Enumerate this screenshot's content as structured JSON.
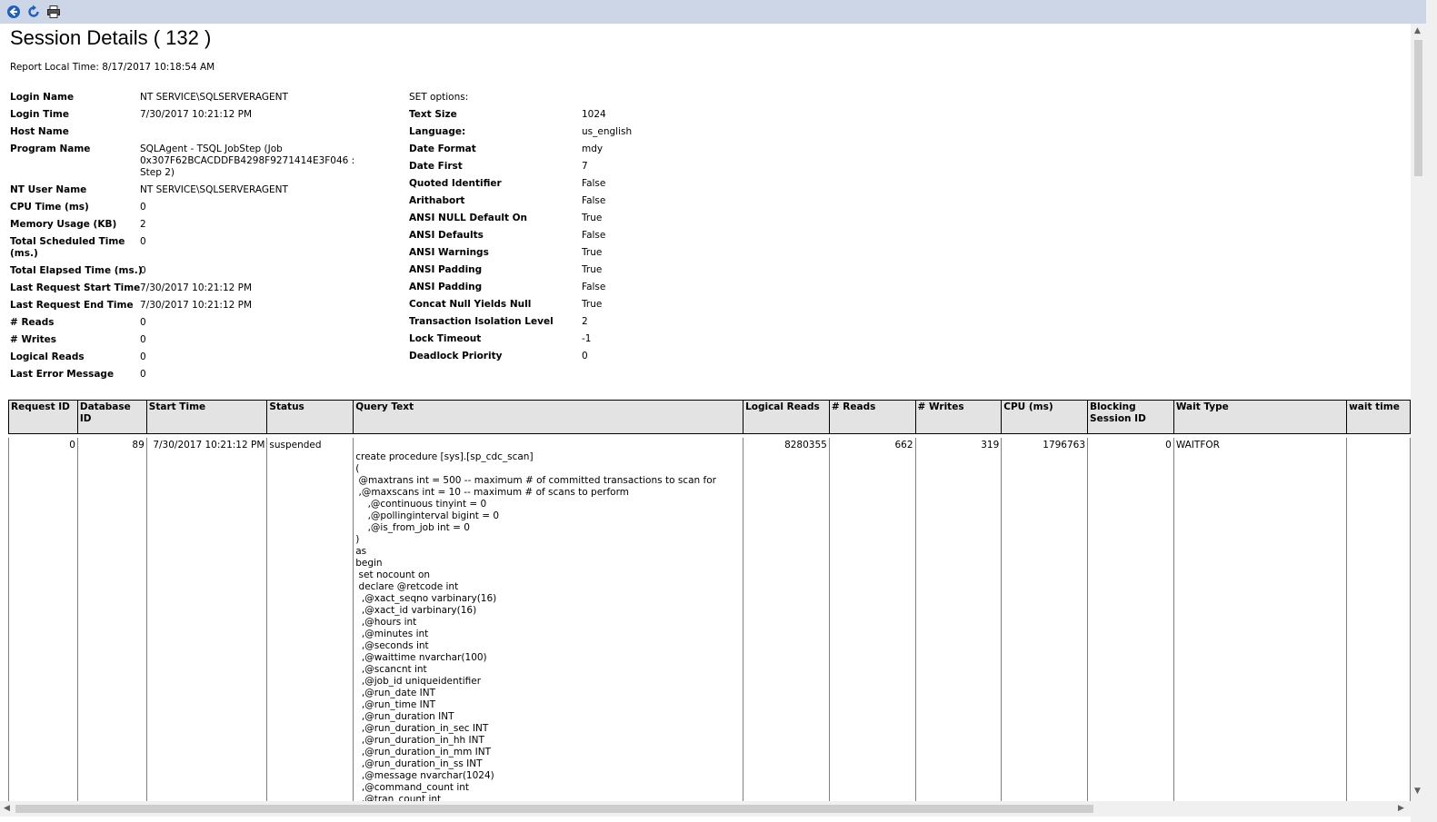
{
  "toolbar": {
    "buttons": [
      "back-icon",
      "refresh-icon",
      "print-icon"
    ]
  },
  "title": "Session Details ( 132 )",
  "report_time": "Report Local Time: 8/17/2017 10:18:54 AM",
  "session": [
    {
      "label": "Login Name",
      "value": "NT SERVICE\\SQLSERVERAGENT"
    },
    {
      "label": "Login Time",
      "value": "7/30/2017 10:21:12 PM"
    },
    {
      "label": "Host Name",
      "value": ""
    },
    {
      "label": "Program Name",
      "value": "SQLAgent - TSQL JobStep (Job"
    },
    {
      "label": "NT User Name",
      "value": "NT SERVICE\\SQLSERVERAGENT"
    },
    {
      "label": "CPU Time (ms)",
      "value": "0"
    },
    {
      "label": "Memory Usage (KB)",
      "value": "2"
    },
    {
      "label": "Total Scheduled Time",
      "value": "0"
    },
    {
      "label": "Total Elapsed Time (ms.)",
      "value": "0"
    },
    {
      "label": "Last Request Start Time",
      "value": "7/30/2017 10:21:12 PM"
    },
    {
      "label": "Last Request End Time",
      "value": "7/30/2017 10:21:12 PM"
    },
    {
      "label": "# Reads",
      "value": "0"
    },
    {
      "label": "# Writes",
      "value": "0"
    },
    {
      "label": "Logical Reads",
      "value": "0"
    },
    {
      "label": "Last Error Message",
      "value": "0"
    }
  ],
  "program_name_cont": [
    "0x307F62BCACDDFB4298F9271414E3F046 :",
    "Step 2)"
  ],
  "total_sched_cont": "(ms.)",
  "set_options_title": "SET options:",
  "set_options": [
    {
      "label": "Text Size",
      "value": "1024"
    },
    {
      "label": "Language:",
      "value": "us_english"
    },
    {
      "label": "Date Format",
      "value": "mdy"
    },
    {
      "label": "Date First",
      "value": "7"
    },
    {
      "label": "Quoted Identifier",
      "value": "False"
    },
    {
      "label": "Arithabort",
      "value": "False"
    },
    {
      "label": "ANSI NULL Default On",
      "value": "True"
    },
    {
      "label": "ANSI Defaults",
      "value": "False"
    },
    {
      "label": "ANSI Warnings",
      "value": "True"
    },
    {
      "label": "ANSI Padding",
      "value": "True"
    },
    {
      "label": "ANSI Padding",
      "value": "False"
    },
    {
      "label": "Concat Null Yields Null",
      "value": "True"
    },
    {
      "label": "Transaction Isolation Level",
      "value": "2"
    },
    {
      "label": "Lock Timeout",
      "value": "-1"
    },
    {
      "label": "Deadlock Priority",
      "value": "0"
    }
  ],
  "requests": {
    "headers": [
      "Request ID",
      "Database ID",
      "Start Time",
      "Status",
      "Query Text",
      "Logical Reads",
      "# Reads",
      "# Writes",
      "CPU (ms)",
      "Blocking Session ID",
      "Wait Type",
      "wait time"
    ],
    "row": {
      "request_id": "0",
      "database_id": "89",
      "start_time": "7/30/2017 10:21:12 PM",
      "status": "suspended",
      "logical_reads": "8280355",
      "reads": "662",
      "writes": "319",
      "cpu": "1796763",
      "blocking": "0",
      "wait_type": "WAITFOR",
      "wait_time": ""
    },
    "query_lines": [
      "create procedure [sys].[sp_cdc_scan]",
      "(",
      " @maxtrans int = 500 -- maximum # of committed transactions to scan for",
      " ,@maxscans int = 10 -- maximum # of scans to perform",
      "    ,@continuous tinyint = 0",
      "    ,@pollinginterval bigint = 0",
      "    ,@is_from_job int = 0",
      ")",
      "as",
      "begin",
      " set nocount on",
      " declare @retcode int",
      "  ,@xact_seqno varbinary(16)",
      "  ,@xact_id varbinary(16)",
      "  ,@hours int",
      "  ,@minutes int",
      "  ,@seconds int",
      "  ,@waittime nvarchar(100)",
      "  ,@scancnt int",
      "  ,@job_id uniqueidentifier",
      "  ,@run_date INT",
      "  ,@run_time INT",
      "  ,@run_duration INT",
      "  ,@run_duration_in_sec INT",
      "  ,@run_duration_in_hh INT",
      "  ,@run_duration_in_mm INT",
      "  ,@run_duration_in_ss INT",
      "  ,@message nvarchar(1024)",
      "  ,@command_count int",
      "  ,@tran_count int"
    ]
  }
}
